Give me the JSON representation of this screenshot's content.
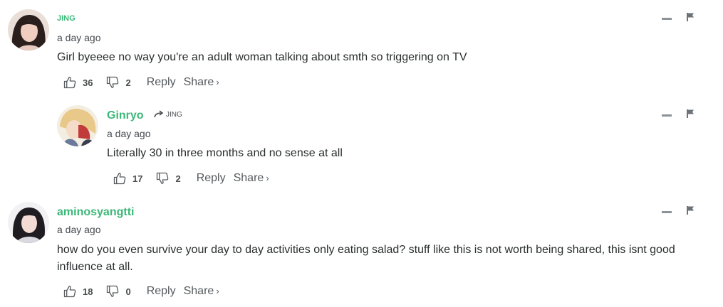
{
  "colors": {
    "author": "#3cb878",
    "text": "#2a2e2e",
    "muted": "#555a5e"
  },
  "icons": {
    "upvote": "thumbs-up-icon",
    "downvote": "thumbs-down-icon",
    "collapse": "minus-icon",
    "flag": "flag-icon",
    "reply_arrow": "arrow-right-icon"
  },
  "comments": [
    {
      "author": "JING",
      "time": "a day ago",
      "text": "Girl byeeee no way you're an adult woman talking about smth so triggering on TV",
      "upvotes": "36",
      "downvotes": "2",
      "reply_label": "Reply",
      "share_label": "Share",
      "share_chevron": "›"
    },
    {
      "author": "Ginryo",
      "reply_to": "JING",
      "time": "a day ago",
      "text": "Literally 30 in three months and no sense at all",
      "upvotes": "17",
      "downvotes": "2",
      "reply_label": "Reply",
      "share_label": "Share",
      "share_chevron": "›"
    },
    {
      "author": "aminosyangtti",
      "time": "a day ago",
      "text": "how do you even survive your day to day activities only eating salad? stuff like this is not worth being shared, this isnt good influence at all.",
      "upvotes": "18",
      "downvotes": "0",
      "reply_label": "Reply",
      "share_label": "Share",
      "share_chevron": "›"
    }
  ]
}
